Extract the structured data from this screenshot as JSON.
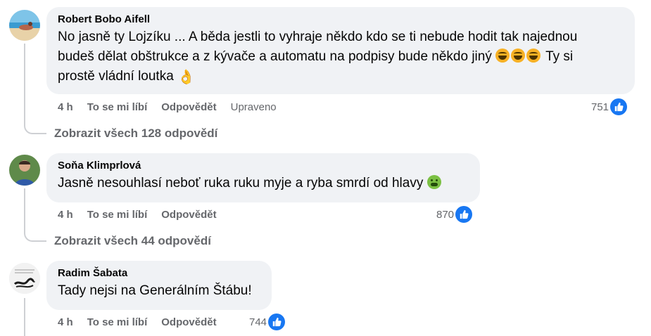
{
  "comments": [
    {
      "author": "Robert Bobo Aifell",
      "text_line1": "No jasně ty Lojzíku ... A běda jestli to vyhraje někdo kdo se ti nebude hodit tak najednou",
      "text_line2": "budeš dělat obštrukce a z kývače a automatu na podpisy bude někdo jiný",
      "text_line2_end": "Ty si",
      "text_line3": "prostě vládní loutka",
      "time": "4 h",
      "like": "To se mi líbí",
      "reply": "Odpovědět",
      "edited": "Upraveno",
      "reaction_count": "751",
      "view_replies": "Zobrazit všech 128 odpovědí"
    },
    {
      "author": "Soňa Klimprlová",
      "text": "Jasně nesouhlasí neboť ruka ruku myje a ryba smrdí od hlavy",
      "time": "4 h",
      "like": "To se mi líbí",
      "reply": "Odpovědět",
      "reaction_count": "870",
      "view_replies": "Zobrazit všech 44 odpovědí"
    },
    {
      "author": "Radim Šabata",
      "text": "Tady nejsi na Generálním Štábu!",
      "time": "4 h",
      "like": "To se mi líbí",
      "reply": "Odpovědět",
      "reaction_count": "744"
    }
  ],
  "icons": {
    "reaction": "like-icon",
    "emoji_laugh": "rolling-on-floor-laughing-emoji",
    "emoji_hand": "ok-hand-emoji",
    "emoji_sick": "nauseated-face-emoji"
  },
  "colors": {
    "bubble": "#f0f2f5",
    "secondary_text": "#65676b",
    "like_blue": "#1877f2"
  }
}
